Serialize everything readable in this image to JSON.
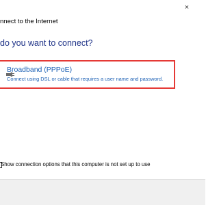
{
  "window": {
    "close_glyph": "×"
  },
  "wizard": {
    "title": "nnect to the Internet",
    "heading": "do you want to connect?"
  },
  "options": [
    {
      "title": "Broadband (PPPoE)",
      "description": "Connect using DSL or cable that requires a user name and password.",
      "icon": "network-cable-icon",
      "highlighted": true,
      "highlight_color": "#e53935"
    }
  ],
  "show_options": {
    "label": "Show connection options that this computer is not set up to use",
    "checked": false
  },
  "colors": {
    "heading": "#1e3287",
    "link": "#1a5fb4",
    "footer": "#f0f0f0"
  }
}
